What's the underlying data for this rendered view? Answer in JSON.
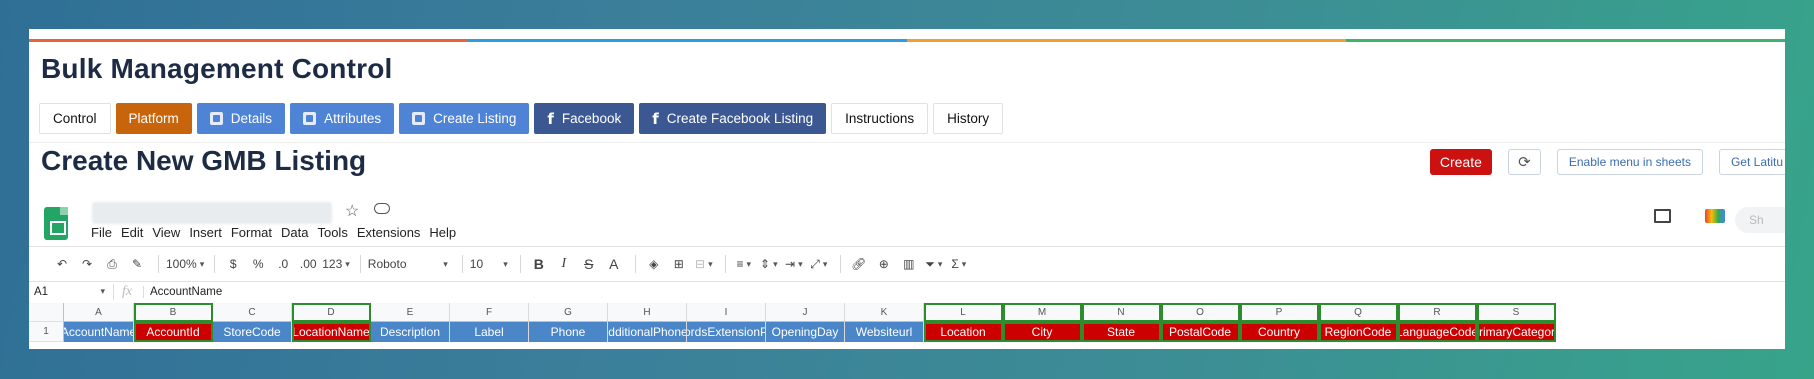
{
  "app": {
    "title": "Bulk Management Control",
    "accent_colors": [
      "#e8623a",
      "#2f9be0",
      "#f0a030",
      "#3db36b"
    ]
  },
  "tabs": [
    {
      "label": "Control",
      "style": "white",
      "icon": ""
    },
    {
      "label": "Platform",
      "style": "orange",
      "icon": ""
    },
    {
      "label": "Details",
      "style": "blue",
      "icon": "sheet-icon"
    },
    {
      "label": "Attributes",
      "style": "blue",
      "icon": "sheet-icon"
    },
    {
      "label": "Create Listing",
      "style": "blue",
      "icon": "sheet-icon"
    },
    {
      "label": "Facebook",
      "style": "navy",
      "icon": "facebook-icon"
    },
    {
      "label": "Create Facebook Listing",
      "style": "navy",
      "icon": "facebook-icon"
    },
    {
      "label": "Instructions",
      "style": "white",
      "icon": ""
    },
    {
      "label": "History",
      "style": "white",
      "icon": ""
    }
  ],
  "section": {
    "title": "Create New GMB Listing",
    "create_label": "Create",
    "refresh_icon": "refresh-icon",
    "enable_menu_label": "Enable menu in sheets",
    "get_lat_label": "Get Latitu"
  },
  "sheets": {
    "menu": [
      "File",
      "Edit",
      "View",
      "Insert",
      "Format",
      "Data",
      "Tools",
      "Extensions",
      "Help"
    ],
    "share_label": "Sh",
    "toolbar": {
      "zoom": "100%",
      "currency": "$",
      "percent": "%",
      "decrease_decimal": ".0",
      "increase_decimal": ".00",
      "number_format": "123",
      "font": "Roboto",
      "font_size": "10",
      "bold": "B",
      "italic": "I",
      "strike": "S",
      "text_color": "A"
    },
    "name_box": "A1",
    "fx": "fx",
    "formula_value": "AccountName",
    "row_number": "1",
    "columns": [
      {
        "letter": "A",
        "header": "AccountName",
        "color": "#4a86c8",
        "framed": false
      },
      {
        "letter": "B",
        "header": "AccountId",
        "color": "#cc0000",
        "framed": true
      },
      {
        "letter": "C",
        "header": "StoreCode",
        "color": "#4a86c8",
        "framed": false
      },
      {
        "letter": "D",
        "header": "LocationName",
        "color": "#cc0000",
        "framed": true
      },
      {
        "letter": "E",
        "header": "Description",
        "color": "#4a86c8",
        "framed": false
      },
      {
        "letter": "F",
        "header": "Label",
        "color": "#4a86c8",
        "framed": false
      },
      {
        "letter": "G",
        "header": "Phone",
        "color": "#4a86c8",
        "framed": false
      },
      {
        "letter": "H",
        "header": "AdditionalPhones",
        "color": "#4a86c8",
        "framed": false
      },
      {
        "letter": "I",
        "header": "eordsExtensionPh",
        "color": "#4a86c8",
        "framed": false
      },
      {
        "letter": "J",
        "header": "OpeningDay",
        "color": "#4a86c8",
        "framed": false
      },
      {
        "letter": "K",
        "header": "Websiteurl",
        "color": "#4a86c8",
        "framed": false
      },
      {
        "letter": "L",
        "header": "Location",
        "color": "#cc0000",
        "framed": true
      },
      {
        "letter": "M",
        "header": "City",
        "color": "#cc0000",
        "framed": true
      },
      {
        "letter": "N",
        "header": "State",
        "color": "#cc0000",
        "framed": true
      },
      {
        "letter": "O",
        "header": "PostalCode",
        "color": "#cc0000",
        "framed": true
      },
      {
        "letter": "P",
        "header": "Country",
        "color": "#cc0000",
        "framed": true
      },
      {
        "letter": "Q",
        "header": "RegionCode",
        "color": "#cc0000",
        "framed": true
      },
      {
        "letter": "R",
        "header": "LanguageCode",
        "color": "#cc0000",
        "framed": true
      },
      {
        "letter": "S",
        "header": "PrimaryCategory",
        "color": "#cc0000",
        "framed": true
      }
    ]
  }
}
